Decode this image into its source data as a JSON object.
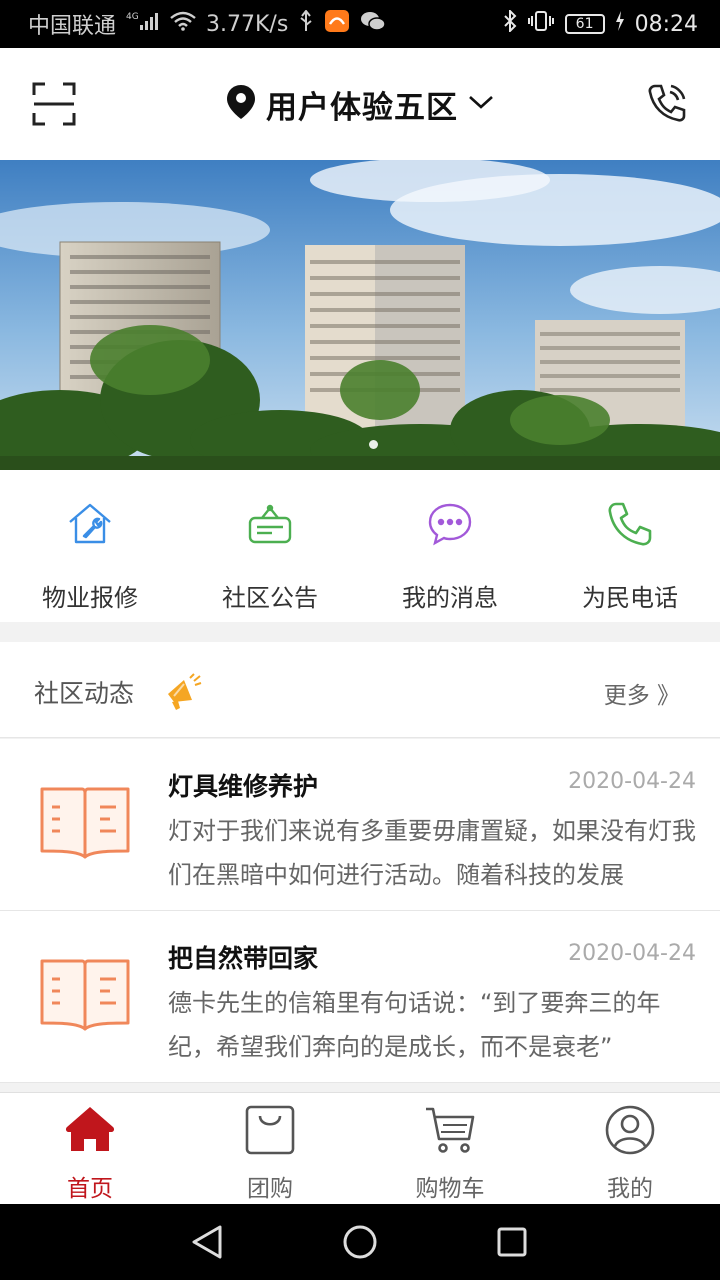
{
  "status_bar": {
    "carrier": "中国联通",
    "network": "4G",
    "speed": "3.77K/s",
    "battery": "61",
    "time": "08:24"
  },
  "header": {
    "community_name": "用户体验五区",
    "icons": [
      "scan-icon",
      "location-pin-icon",
      "chevron-down-icon",
      "phone-call-icon"
    ]
  },
  "banner": {
    "slide_count": 1,
    "active_slide": 1
  },
  "quick_menu": [
    {
      "label": "物业报修",
      "icon": "house-repair-icon",
      "color": "#3a8ee6"
    },
    {
      "label": "社区公告",
      "icon": "notice-board-icon",
      "color": "#4caf50"
    },
    {
      "label": "我的消息",
      "icon": "message-bubble-icon",
      "color": "#a259d9"
    },
    {
      "label": "为民电话",
      "icon": "phone-icon",
      "color": "#4caf50"
    }
  ],
  "news": {
    "section_title": "社区动态",
    "more_label": "更多 》",
    "items": [
      {
        "title": "灯具维修养护",
        "date": "2020-04-24",
        "desc": "灯对于我们来说有多重要毋庸置疑，如果没有灯我们在黑暗中如何进行活动。随着科技的发展"
      },
      {
        "title": "把自然带回家",
        "date": "2020-04-24",
        "desc": "德卡先生的信箱里有句话说：“到了要奔三的年纪，希望我们奔向的是成长，而不是衰老”"
      }
    ]
  },
  "tab_bar": [
    {
      "label": "首页",
      "icon": "home-icon",
      "active": true
    },
    {
      "label": "团购",
      "icon": "shopping-bag-icon",
      "active": false
    },
    {
      "label": "购物车",
      "icon": "cart-icon",
      "active": false
    },
    {
      "label": "我的",
      "icon": "user-icon",
      "active": false
    }
  ],
  "colors": {
    "accent": "#c0161c",
    "book_icon": "#f0875a"
  }
}
